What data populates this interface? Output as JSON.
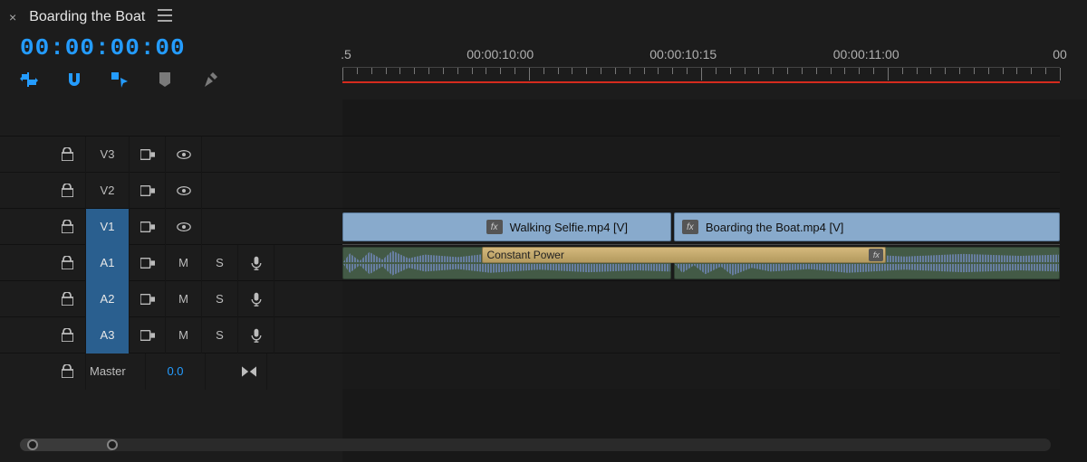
{
  "sequence_title": "Boarding the Boat",
  "timecode": "00:00:00:00",
  "ruler": {
    "labels": [
      {
        "text": ".5",
        "pct": 0.5
      },
      {
        "text": "00:00:10:00",
        "pct": 22
      },
      {
        "text": "00:00:10:15",
        "pct": 47.5
      },
      {
        "text": "00:00:11:00",
        "pct": 73
      },
      {
        "text": "00",
        "pct": 100
      }
    ]
  },
  "tools": [
    "insert-overwrite",
    "snap",
    "linked-selection",
    "markers",
    "settings"
  ],
  "tracks": {
    "video": [
      {
        "name": "V3",
        "active": false
      },
      {
        "name": "V2",
        "active": false
      },
      {
        "name": "V1",
        "active": true
      }
    ],
    "audio": [
      {
        "name": "A1",
        "active": true
      },
      {
        "name": "A2",
        "active": true
      },
      {
        "name": "A3",
        "active": true
      }
    ],
    "master_label": "Master",
    "master_value": "0.0"
  },
  "buttons": {
    "mute": "M",
    "solo": "S"
  },
  "clips": {
    "v1": [
      {
        "label": "Walking Selfie.mp4 [V]",
        "start_pct": 0,
        "end_pct": 45.8,
        "label_left_pct": 19
      },
      {
        "label": "Boarding the Boat.mp4 [V]",
        "start_pct": 46.2,
        "end_pct": 100
      }
    ],
    "a1": [
      {
        "start_pct": 0,
        "end_pct": 45.8
      },
      {
        "start_pct": 46.2,
        "end_pct": 100
      }
    ],
    "transition": {
      "label": "Constant Power",
      "start_pct": 19.5,
      "end_pct": 75.8
    }
  },
  "colors": {
    "accent": "#249cff",
    "playhead": "#d52b1e",
    "video_clip": "#88aacc",
    "audio_clip": "#435a46",
    "transition": "#c7ac70"
  }
}
